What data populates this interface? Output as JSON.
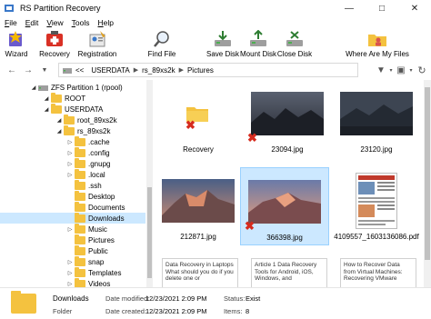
{
  "window": {
    "title": "RS Partition Recovery"
  },
  "menu": [
    {
      "label": "File",
      "key": "F",
      "rest": "ile"
    },
    {
      "label": "Edit",
      "key": "E",
      "rest": "dit"
    },
    {
      "label": "View",
      "key": "V",
      "rest": "iew"
    },
    {
      "label": "Tools",
      "key": "T",
      "rest": "ools"
    },
    {
      "label": "Help",
      "key": "H",
      "rest": "elp"
    }
  ],
  "toolbar": {
    "wizard": "Wizard",
    "recovery": "Recovery",
    "registration": "Registration",
    "find_file": "Find File",
    "save_disk": "Save Disk",
    "mount_disk": "Mount Disk",
    "close_disk": "Close Disk",
    "where_are_my_files": "Where Are My Files"
  },
  "breadcrumb": {
    "prefix": "<<",
    "segments": [
      "USERDATA",
      "rs_89xs2k",
      "Pictures"
    ]
  },
  "tree": [
    {
      "label": "ZFS Partition 1 (rpool)"
    },
    {
      "label": "ROOT"
    },
    {
      "label": "USERDATA"
    },
    {
      "label": "root_89xs2k"
    },
    {
      "label": "rs_89xs2k"
    },
    {
      "label": ".cache"
    },
    {
      "label": ".config"
    },
    {
      "label": ".gnupg"
    },
    {
      "label": ".local"
    },
    {
      "label": ".ssh"
    },
    {
      "label": "Desktop"
    },
    {
      "label": "Documents"
    },
    {
      "label": "Downloads"
    },
    {
      "label": "Music"
    },
    {
      "label": "Pictures"
    },
    {
      "label": "Public"
    },
    {
      "label": "snap"
    },
    {
      "label": "Templates"
    },
    {
      "label": "Videos"
    }
  ],
  "files": [
    {
      "name": "Recovery"
    },
    {
      "name": "23094.jpg"
    },
    {
      "name": "23120.jpg"
    },
    {
      "name": "212871.jpg"
    },
    {
      "name": "366398.jpg"
    },
    {
      "name": "4109557_1603136086.pdf"
    },
    {
      "name": "",
      "preview": "Data Recovery in Laptops What should you do if you delete one or"
    },
    {
      "name": "",
      "preview": "Article 1 Data Recovery Tools for Android, iOS, Windows, and"
    },
    {
      "name": "",
      "preview": "How to Recover Data from Virtual Machines: Recovering VMware"
    }
  ],
  "status": {
    "name": "Downloads",
    "type": "Folder",
    "modified_label": "Date modified:",
    "modified_value": "12/23/2021 2:09 PM",
    "created_label": "Date created:",
    "created_value": "12/23/2021 2:09 PM",
    "status_label": "Status:",
    "status_value": "Exist",
    "items_label": "Items:",
    "items_value": "8"
  },
  "colors": {
    "selection": "#cce8ff",
    "folder": "#f4c23f",
    "deleted_mark": "#d62b1e"
  }
}
